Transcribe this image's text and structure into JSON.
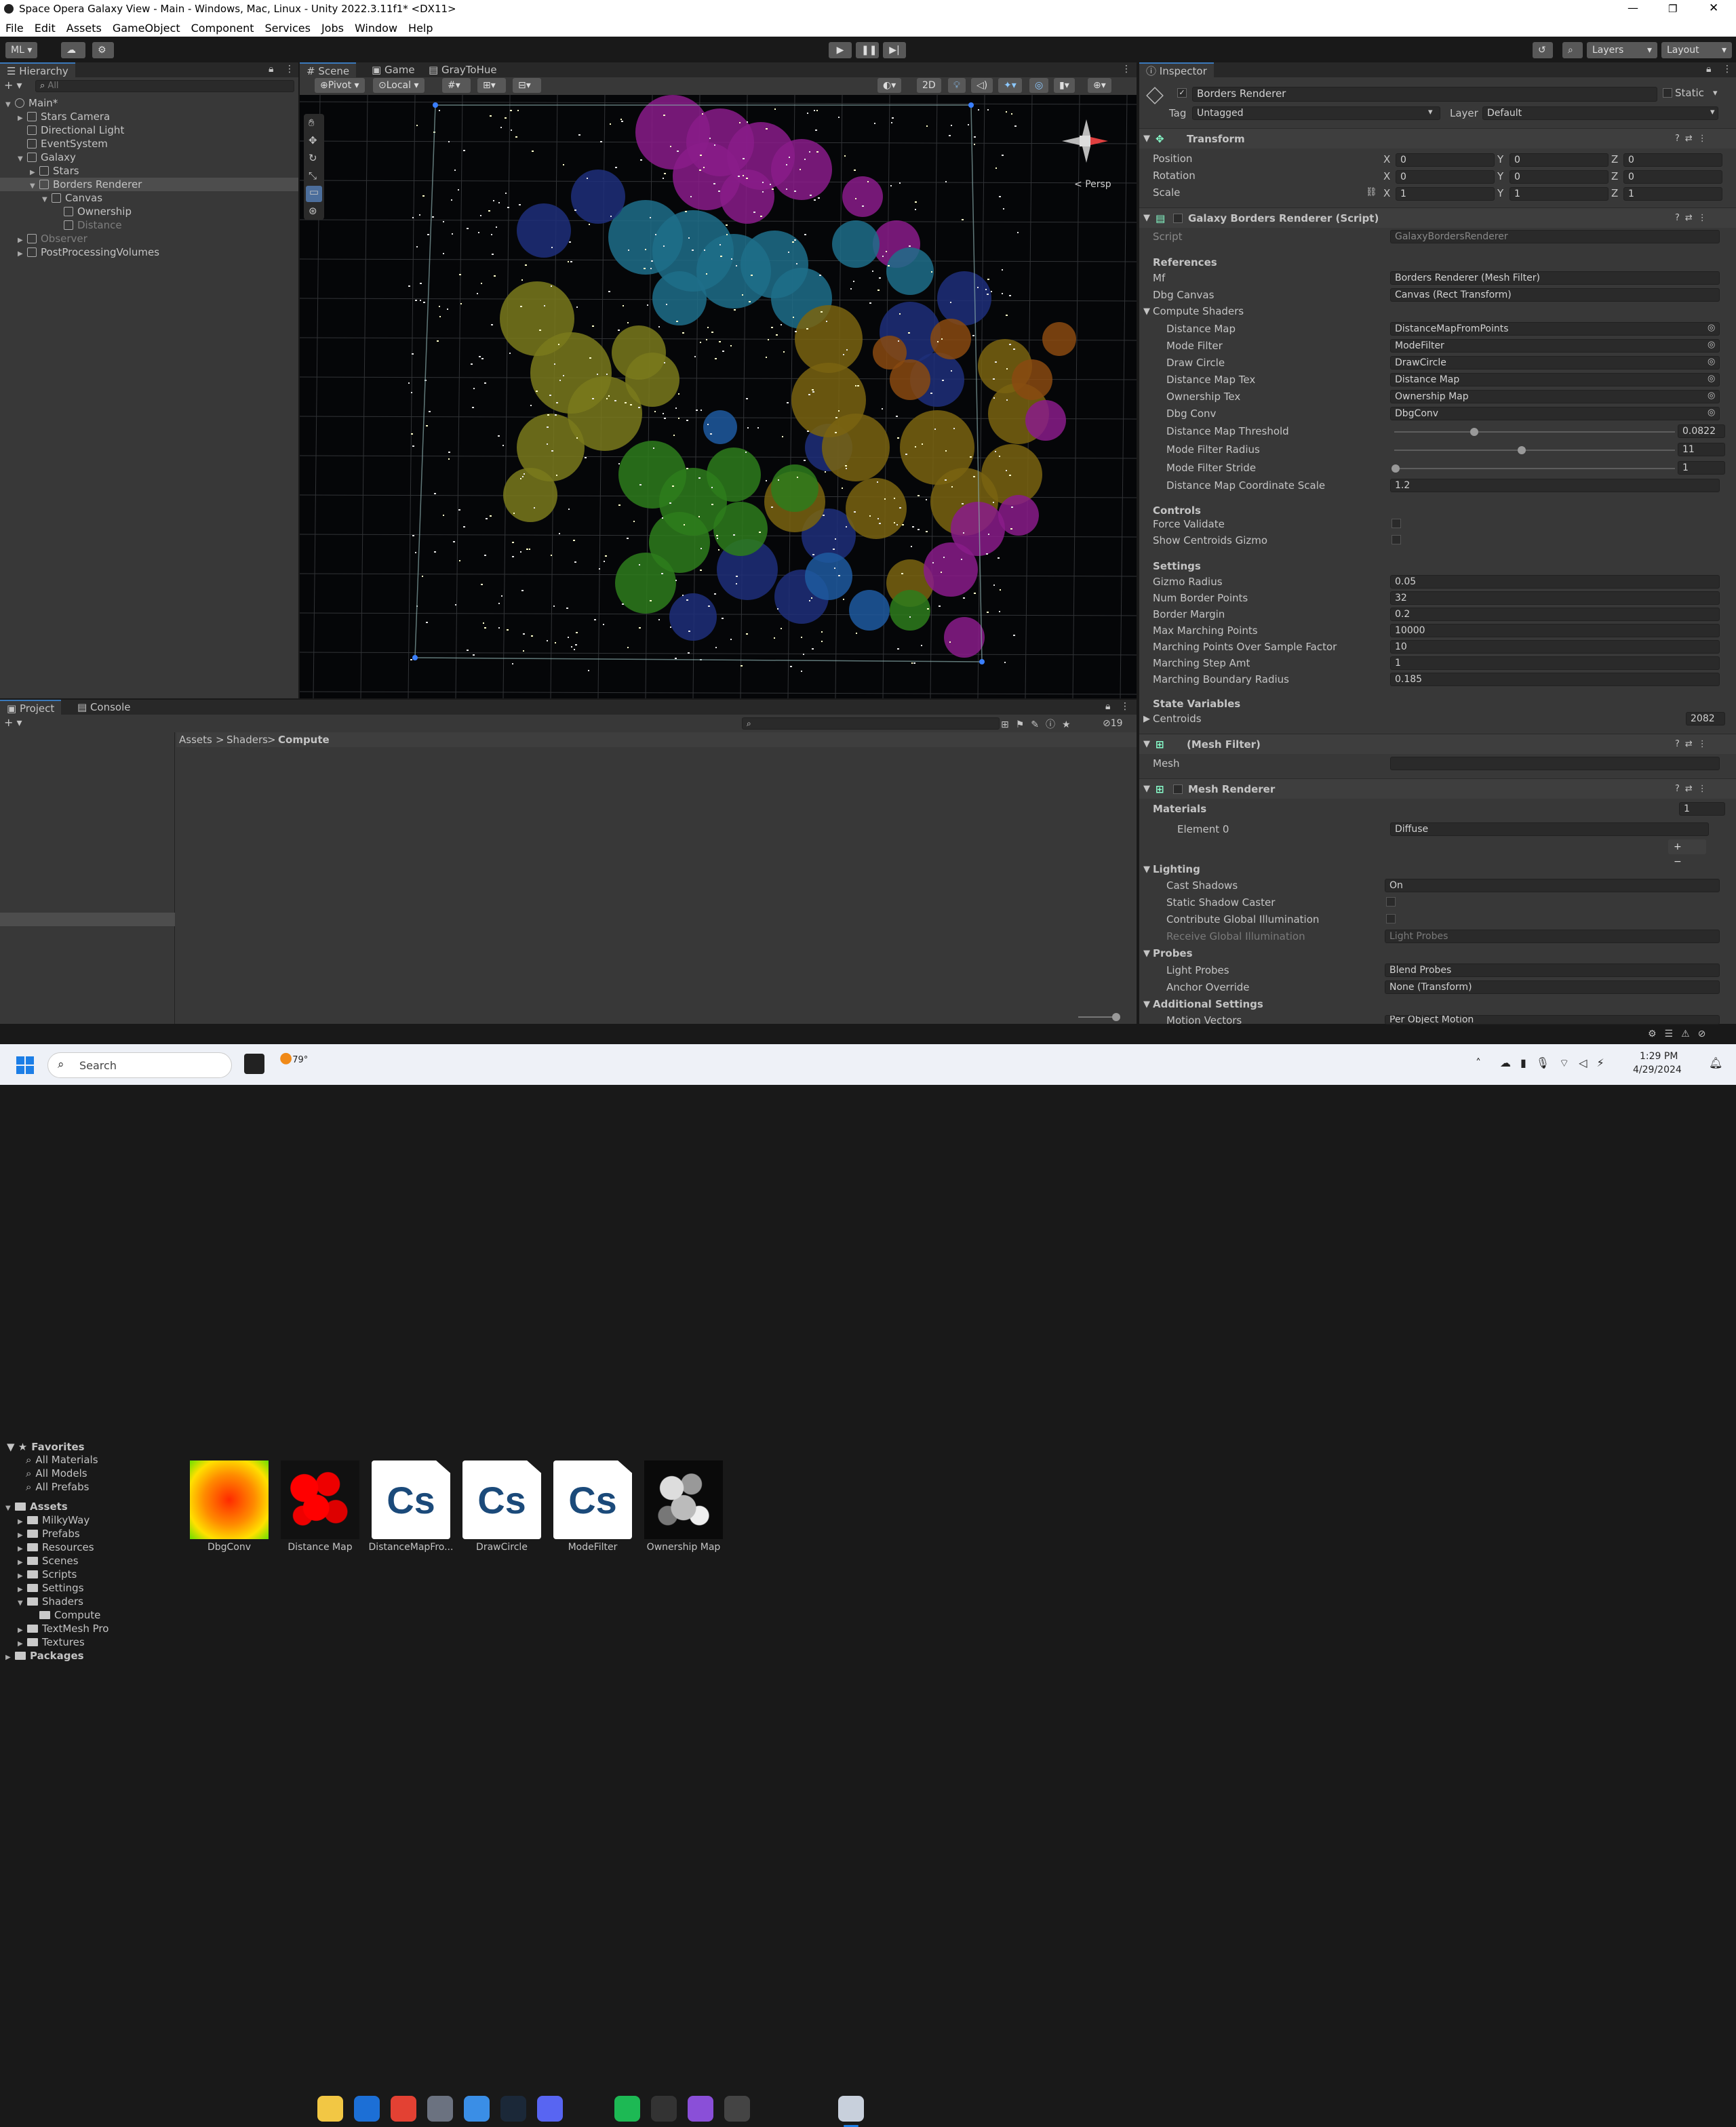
{
  "window": {
    "title": "Space Opera Galaxy View - Main - Windows, Mac, Linux - Unity 2022.3.11f1* <DX11>"
  },
  "menu": [
    "File",
    "Edit",
    "Assets",
    "GameObject",
    "Component",
    "Services",
    "Jobs",
    "Window",
    "Help"
  ],
  "toolbar": {
    "account": "ML",
    "layers": "Layers",
    "layout": "Layout"
  },
  "hierarchy": {
    "tab": "Hierarchy",
    "search_placeholder": "All",
    "items": [
      {
        "label": "Main*",
        "indent": 0,
        "arrow": "▼"
      },
      {
        "label": "Stars Camera",
        "indent": 1,
        "arrow": "▶"
      },
      {
        "label": "Directional Light",
        "indent": 1,
        "arrow": ""
      },
      {
        "label": "EventSystem",
        "indent": 1,
        "arrow": ""
      },
      {
        "label": "Galaxy",
        "indent": 1,
        "arrow": "▼"
      },
      {
        "label": "Stars",
        "indent": 2,
        "arrow": "▶"
      },
      {
        "label": "Borders Renderer",
        "indent": 2,
        "arrow": "▼"
      },
      {
        "label": "Canvas",
        "indent": 3,
        "arrow": "▼"
      },
      {
        "label": "Ownership",
        "indent": 4,
        "arrow": ""
      },
      {
        "label": "Distance",
        "indent": 4,
        "arrow": ""
      },
      {
        "label": "Observer",
        "indent": 1,
        "arrow": "▶"
      },
      {
        "label": "PostProcessingVolumes",
        "indent": 1,
        "arrow": "▶"
      }
    ]
  },
  "scene": {
    "tabs": [
      "Scene",
      "Game",
      "GrayToHue"
    ],
    "pivot": "Pivot",
    "local": "Local",
    "mode2d": "2D",
    "persp": "Persp"
  },
  "project": {
    "tabs": [
      "Project",
      "Console"
    ],
    "hidden_count": "19",
    "favorites": [
      "Favorites",
      "All Materials",
      "All Models",
      "All Prefabs"
    ],
    "assets_tree": [
      "Assets",
      "MilkyWay",
      "Prefabs",
      "Resources",
      "Scenes",
      "Scripts",
      "Settings",
      "Shaders",
      "Compute",
      "TextMesh Pro",
      "Textures",
      "Packages"
    ],
    "breadcrumb": [
      "Assets",
      "Shaders",
      "Compute"
    ],
    "files": [
      {
        "name": "DbgConv",
        "kind": "gradient"
      },
      {
        "name": "Distance Map",
        "kind": "redmap"
      },
      {
        "name": "DistanceMapFro...",
        "kind": "cs"
      },
      {
        "name": "DrawCircle",
        "kind": "cs"
      },
      {
        "name": "ModeFilter",
        "kind": "cs"
      },
      {
        "name": "Ownership Map",
        "kind": "bw"
      }
    ],
    "cs_label": "Cs"
  },
  "inspector": {
    "tab": "Inspector",
    "object_name": "Borders Renderer",
    "static": "Static",
    "tag_label": "Tag",
    "tag": "Untagged",
    "layer_label": "Layer",
    "layer": "Default",
    "transform": {
      "title": "Transform",
      "rows": [
        {
          "label": "Position",
          "x": "0",
          "y": "0",
          "z": "0"
        },
        {
          "label": "Rotation",
          "x": "0",
          "y": "0",
          "z": "0"
        },
        {
          "label": "Scale",
          "x": "1",
          "y": "1",
          "z": "1"
        }
      ]
    },
    "script_comp": {
      "title": "Galaxy Borders Renderer (Script)",
      "script_label": "Script",
      "script": "GalaxyBordersRenderer",
      "refs_title": "References",
      "mf_label": "Mf",
      "mf": "Borders Renderer (Mesh Filter)",
      "dbg_label": "Dbg Canvas",
      "dbg": "Canvas (Rect Transform)",
      "cs_title": "Compute Shaders",
      "cs": [
        {
          "label": "Distance Map",
          "value": "DistanceMapFromPoints"
        },
        {
          "label": "Mode Filter",
          "value": "ModeFilter"
        },
        {
          "label": "Draw Circle",
          "value": "DrawCircle"
        },
        {
          "label": "Distance Map Tex",
          "value": "Distance Map"
        },
        {
          "label": "Ownership Tex",
          "value": "Ownership Map"
        },
        {
          "label": "Dbg Conv",
          "value": "DbgConv"
        }
      ],
      "sliders": [
        {
          "label": "Distance Map Threshold",
          "value": "0.0822",
          "pos": 0.28
        },
        {
          "label": "Mode Filter Radius",
          "value": "11",
          "pos": 0.45
        },
        {
          "label": "Mode Filter Stride",
          "value": "1",
          "pos": 0
        }
      ],
      "coord_label": "Distance Map Coordinate Scale",
      "coord": "1.2",
      "controls_title": "Controls",
      "force_validate": "Force Validate",
      "show_gizmo": "Show Centroids Gizmo",
      "settings_title": "Settings",
      "settings": [
        {
          "label": "Gizmo Radius",
          "value": "0.05"
        },
        {
          "label": "Num Border Points",
          "value": "32"
        },
        {
          "label": "Border Margin",
          "value": "0.2"
        },
        {
          "label": "Max Marching Points",
          "value": "10000"
        },
        {
          "label": "Marching Points Over Sample Factor",
          "value": "10"
        },
        {
          "label": "Marching Step Amt",
          "value": "1"
        },
        {
          "label": "Marching Boundary Radius",
          "value": "0.185"
        }
      ],
      "state_title": "State Variables",
      "centroids_label": "Centroids",
      "centroids": "2082"
    },
    "mesh_filter": {
      "title": "(Mesh Filter)",
      "mesh_label": "Mesh"
    },
    "mesh_renderer": {
      "title": "Mesh Renderer",
      "materials_label": "Materials",
      "materials_count": "1",
      "element_label": "Element 0",
      "element": "Diffuse",
      "lighting": "Lighting",
      "cast_label": "Cast Shadows",
      "cast": "On",
      "static_caster": "Static Shadow Caster",
      "contrib_gi": "Contribute Global Illumination",
      "receive_gi": "Receive Global Illumination",
      "receive_val": "Light Probes",
      "probes": "Probes",
      "lp_label": "Light Probes",
      "lp": "Blend Probes",
      "anchor_label": "Anchor Override",
      "anchor": "None (Transform)",
      "additional": "Additional Settings",
      "mv_label": "Motion Vectors",
      "mv": "Per Object Motion"
    }
  },
  "taskbar": {
    "search": "Search",
    "temp": "79°",
    "time": "1:29 PM",
    "date": "4/29/2024"
  }
}
